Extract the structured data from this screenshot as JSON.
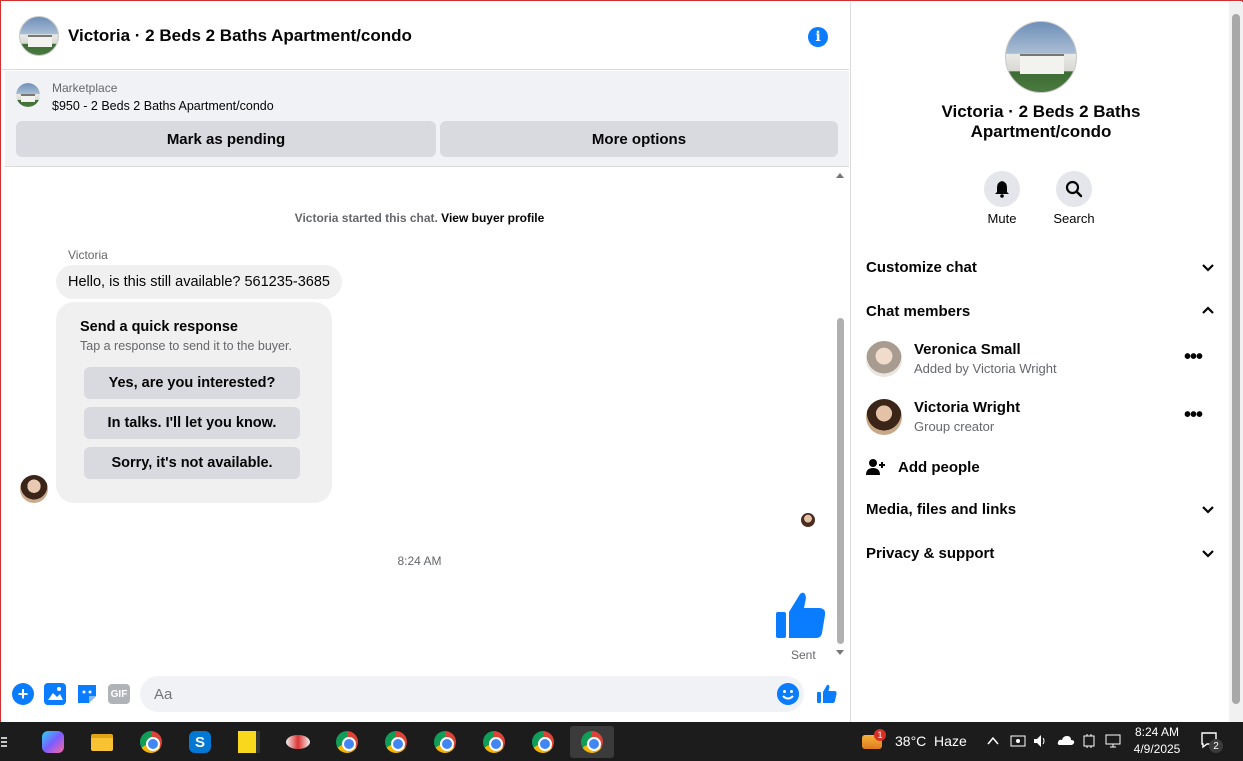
{
  "chat": {
    "title": "Victoria · 2 Beds 2 Baths Apartment/condo",
    "marketplace_label": "Marketplace",
    "listing": "$950 - 2 Beds 2 Baths Apartment/condo",
    "mark_pending_label": "Mark as pending",
    "more_options_label": "More options",
    "started_text": "Victoria started this chat.",
    "view_buyer_label": "View buyer profile",
    "sender_name": "Victoria",
    "incoming_message": "Hello, is this still available? 561235-3685",
    "quick_title": "Send a quick response",
    "quick_sub": "Tap a response to send it to the buyer.",
    "quick_responses": [
      "Yes, are you interested?",
      "In talks. I'll let you know.",
      "Sorry, it's not available."
    ],
    "timestamp": "8:24 AM",
    "sent_label": "Sent",
    "composer_placeholder": "Aa",
    "gif_label": "GIF"
  },
  "info": {
    "title": "Victoria · 2 Beds 2 Baths Apartment/condo",
    "mute_label": "Mute",
    "search_label": "Search",
    "customize_label": "Customize chat",
    "members_label": "Chat members",
    "members": [
      {
        "name": "Veronica Small",
        "sub": "Added by Victoria Wright"
      },
      {
        "name": "Victoria Wright",
        "sub": "Group creator"
      }
    ],
    "add_people_label": "Add people",
    "media_label": "Media, files and links",
    "privacy_label": "Privacy & support"
  },
  "taskbar": {
    "weather_badge": "1",
    "weather_text": "38°C  Haze",
    "time": "8:24 AM",
    "date": "4/9/2025",
    "notif_count": "2"
  },
  "colors": {
    "accent": "#0a7cff",
    "bubble": "#f0f0f0",
    "button_gray": "#d8dadf"
  }
}
